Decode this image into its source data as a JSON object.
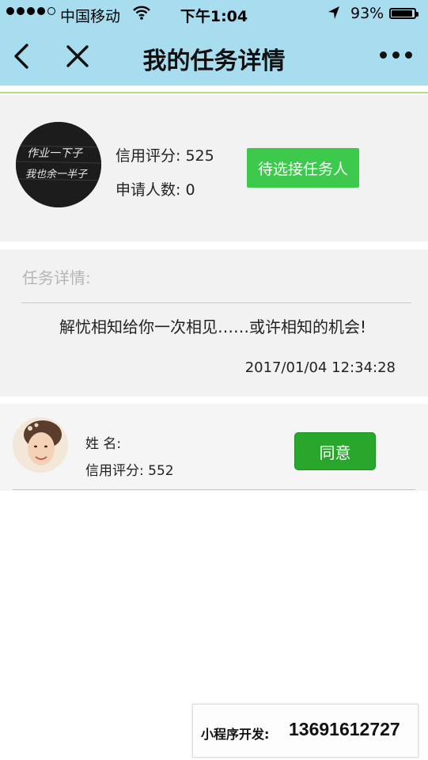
{
  "status_bar": {
    "carrier": "中国移动",
    "time": "下午1:04",
    "battery": "93%",
    "battery_level": 0.93,
    "signal_bars": 4,
    "signal_total": 5,
    "icons": [
      "signal-dots-icon",
      "wifi-icon",
      "location-arrow-icon",
      "battery-icon"
    ]
  },
  "nav": {
    "title": "我的任务详情",
    "icons": [
      "back-chevron-icon",
      "close-icon",
      "more-dots-icon"
    ]
  },
  "task_owner": {
    "credit_label": "信用评分: 525",
    "applicants_label": "申请人数: 0",
    "button_label": "待选接任务人",
    "button_color": "#3dc94b",
    "avatar_handwriting": [
      "作业一下子",
      "我也余一半子"
    ]
  },
  "task_detail": {
    "label": "任务详情:",
    "content": "解忧相知给你一次相见……或许相知的机会!",
    "date": "2017/01/04 12:34:28"
  },
  "applicant": {
    "name_label": "姓 名:",
    "credit_label": "信用评分: 552",
    "button_label": "同意",
    "button_color": "#28a72c"
  },
  "watermark": {
    "label": "小程序开发:",
    "phone": "13691612727"
  },
  "colors": {
    "header_bg": "#a8dcef",
    "accent_line": "#b6e07a",
    "card_bg": "#f2f2f2"
  }
}
